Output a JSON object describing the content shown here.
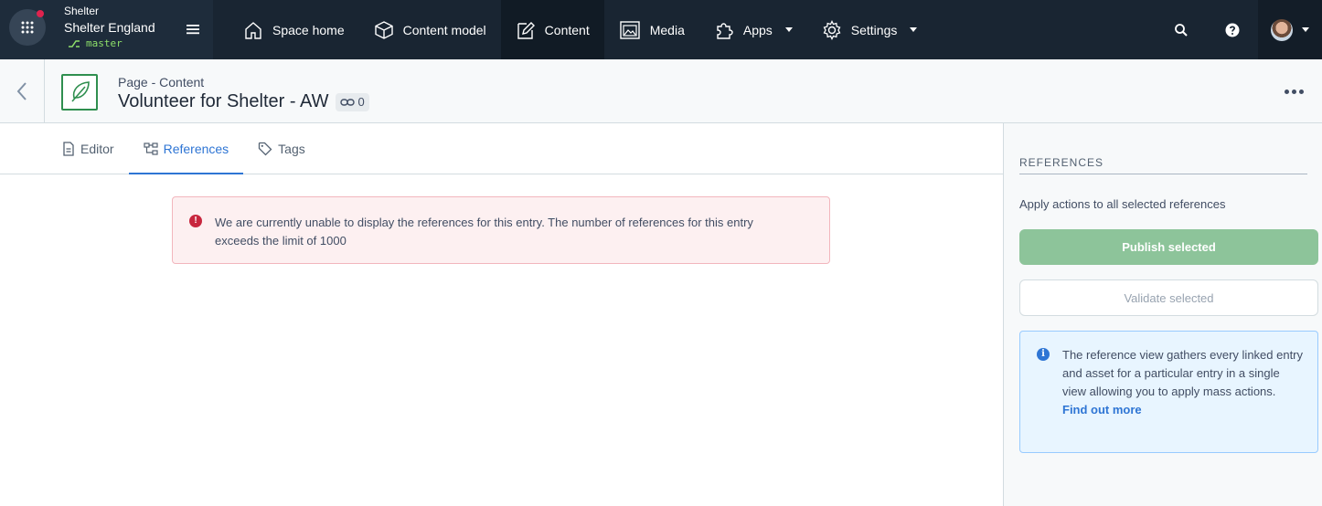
{
  "topbar": {
    "org_name": "Shelter",
    "space_name": "Shelter England",
    "environment": "master",
    "nav_items": [
      {
        "label": "Space home",
        "icon": "home-icon"
      },
      {
        "label": "Content model",
        "icon": "content-model-icon"
      },
      {
        "label": "Content",
        "icon": "content-icon",
        "active": true
      },
      {
        "label": "Media",
        "icon": "media-icon"
      },
      {
        "label": "Apps",
        "icon": "apps-puzzle-icon",
        "dropdown": true
      },
      {
        "label": "Settings",
        "icon": "gear-icon",
        "dropdown": true
      }
    ]
  },
  "entry": {
    "type_label": "Page - Content",
    "title": "Volunteer for Shelter - AW",
    "link_count": "0"
  },
  "tabs": [
    {
      "label": "Editor",
      "icon": "document-icon"
    },
    {
      "label": "References",
      "icon": "references-icon",
      "active": true
    },
    {
      "label": "Tags",
      "icon": "tag-icon"
    }
  ],
  "error_note": {
    "line1": "We are currently unable to display the references for this entry. The number of references for this entry",
    "line2": "exceeds the limit of 1000"
  },
  "sidebar": {
    "heading": "REFERENCES",
    "description": "Apply actions to all selected references",
    "publish_label": "Publish selected",
    "validate_label": "Validate selected",
    "info_text": "The reference view gathers every linked entry and asset for a particular entry in a single view allowing you to apply mass actions.",
    "info_link": "Find out more"
  },
  "colors": {
    "nav_bg": "#192532",
    "accent": "#2e75d4",
    "publish_green": "#8dc49a",
    "error_red": "#c8263e"
  }
}
